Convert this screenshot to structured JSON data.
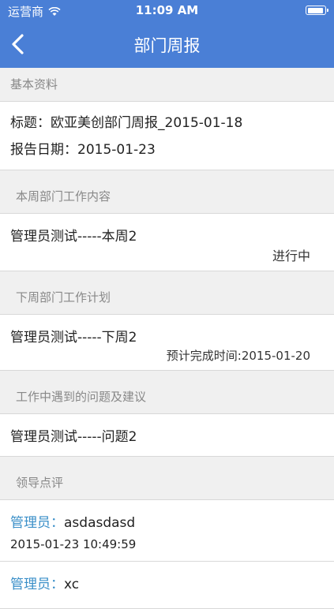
{
  "status": {
    "carrier": "运营商",
    "time": "11:09 AM"
  },
  "nav": {
    "title": "部门周报"
  },
  "basic": {
    "header": "基本资料",
    "title_label": "标题：",
    "title_value": "欧亚美创部门周报_2015-01-18",
    "date_label": "报告日期：",
    "date_value": "2015-01-23"
  },
  "this_week": {
    "header": "本周部门工作内容",
    "item": "管理员测试-----本周2",
    "status": "进行中"
  },
  "next_week": {
    "header": "下周部门工作计划",
    "item": "管理员测试-----下周2",
    "due": "预计完成时间:2015-01-20"
  },
  "problems": {
    "header": "工作中遇到的问题及建议",
    "item": "管理员测试-----问题2"
  },
  "comments": {
    "header": "领导点评",
    "items": [
      {
        "author": "管理员：",
        "text": "asdasdasd",
        "time": "2015-01-23 10:49:59"
      },
      {
        "author": "管理员：",
        "text": "xc",
        "time": ""
      }
    ]
  }
}
